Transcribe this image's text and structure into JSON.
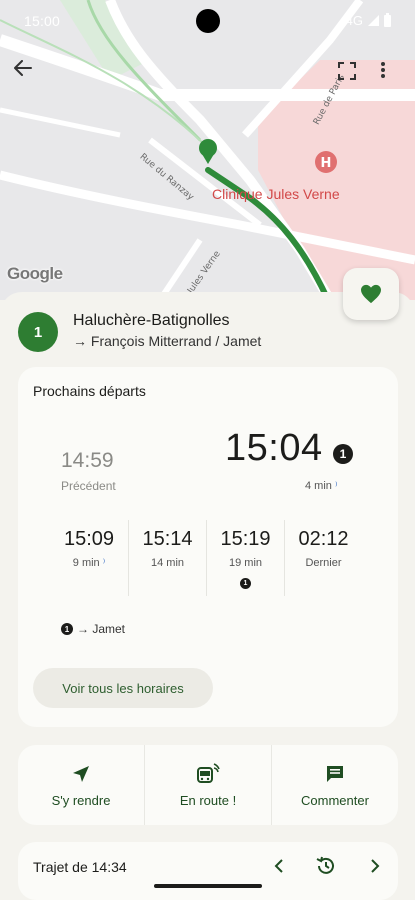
{
  "status": {
    "time": "15:00",
    "network": "4G"
  },
  "map": {
    "clinic_label": "Clinique Jules Verne",
    "clinic_marker": "H",
    "streets": [
      "Rue du Ranzay",
      "Rue de Paris",
      "Jules Verne"
    ],
    "attribution": "Google",
    "route_color": "#2e8b3a"
  },
  "line": {
    "number": "1",
    "name": "Haluchère-Batignolles",
    "direction": "→ François Mitterrand / Jamet",
    "color": "#2e7d32"
  },
  "departures": {
    "title": "Prochains départs",
    "previous": {
      "time": "14:59",
      "label": "Précédent"
    },
    "next": {
      "time": "15:04",
      "badge": "1",
      "minutes": "4 min"
    },
    "upcoming": [
      {
        "time": "15:09",
        "sub": "9 min",
        "realtime": true,
        "badge": false
      },
      {
        "time": "15:14",
        "sub": "14 min",
        "realtime": false,
        "badge": false
      },
      {
        "time": "15:19",
        "sub": "19 min",
        "realtime": false,
        "badge": true
      },
      {
        "time": "02:12",
        "sub": "Dernier",
        "realtime": false,
        "badge": false
      }
    ],
    "destination_badge": "1",
    "destination": "→ Jamet",
    "see_all_label": "Voir tous les horaires"
  },
  "actions": [
    {
      "label": "S'y rendre",
      "icon": "navigation-arrow-icon"
    },
    {
      "label": "En route !",
      "icon": "bus-realtime-icon"
    },
    {
      "label": "Commenter",
      "icon": "comment-icon"
    }
  ],
  "trip": {
    "label": "Trajet de 14:34"
  },
  "colors": {
    "accent": "#2e7d32",
    "background": "#f4f3ee",
    "card": "#fbfbf8",
    "realtime": "#3a6fc4",
    "clinic": "#d24848"
  }
}
